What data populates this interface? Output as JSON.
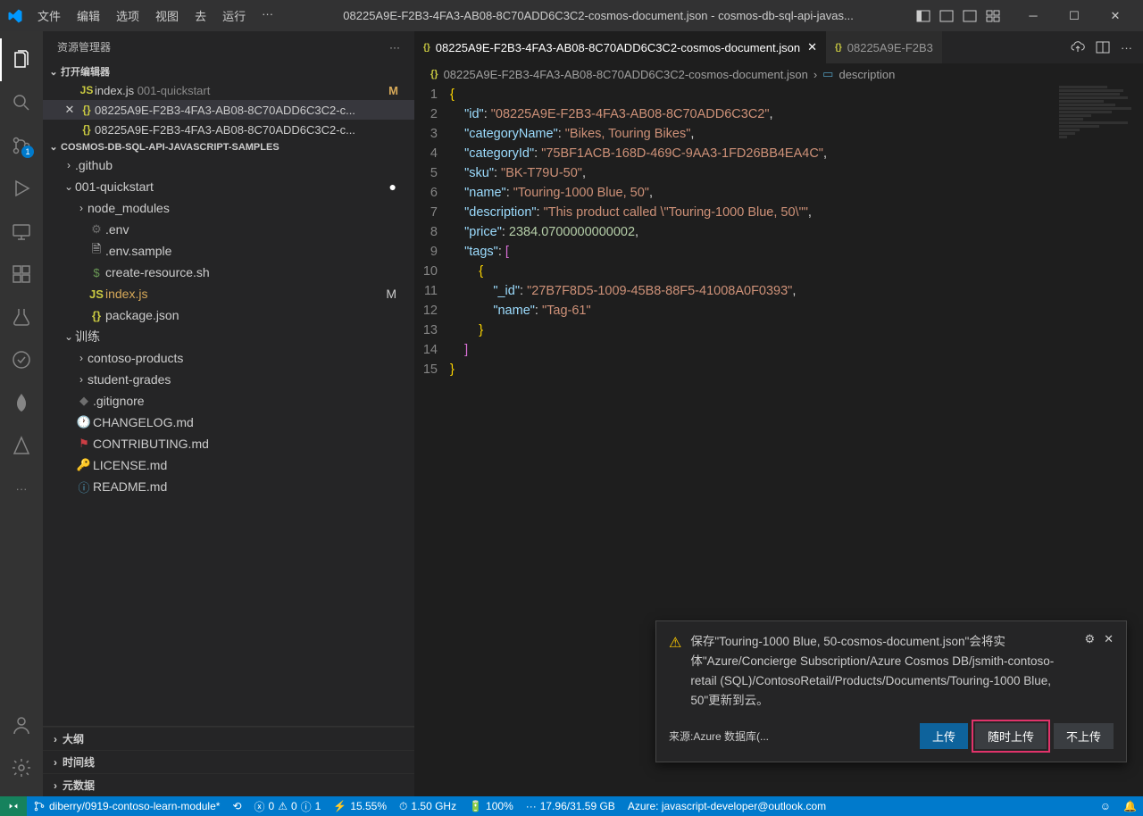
{
  "titlebar": {
    "title": "08225A9E-F2B3-4FA3-AB08-8C70ADD6C3C2-cosmos-document.json - cosmos-db-sql-api-javas...",
    "menu": [
      "文件",
      "编辑",
      "选项",
      "视图",
      "去",
      "运行",
      "···"
    ]
  },
  "sidebar": {
    "title": "资源管理器",
    "open_editors": "打开编辑器",
    "editors": [
      {
        "name": "index.js",
        "detail": "001-quickstart",
        "icon": "JS",
        "modified": "M"
      },
      {
        "name": "08225A9E-F2B3-4FA3-AB08-8C70ADD6C3C2-c...",
        "icon": "{}",
        "active": true,
        "close_visible": true
      },
      {
        "name": "08225A9E-F2B3-4FA3-AB08-8C70ADD6C3C2-c...",
        "icon": "{}"
      }
    ],
    "workspace": "COSMOS-DB-SQL-API-JAVASCRIPT-SAMPLES",
    "tree": [
      {
        "type": "folder",
        "name": ".github",
        "indent": 1,
        "expanded": false
      },
      {
        "type": "folder",
        "name": "001-quickstart",
        "indent": 1,
        "expanded": true,
        "dot": true
      },
      {
        "type": "folder",
        "name": "node_modules",
        "indent": 2,
        "expanded": false
      },
      {
        "type": "file",
        "name": ".env",
        "indent": 2,
        "iconClass": "i-gear",
        "icon": "⚙"
      },
      {
        "type": "file",
        "name": ".env.sample",
        "indent": 2,
        "iconClass": "i-folder",
        "icon": "🗎"
      },
      {
        "type": "file",
        "name": "create-resource.sh",
        "indent": 2,
        "iconClass": "i-dollar",
        "icon": "$"
      },
      {
        "type": "file",
        "name": "index.js",
        "indent": 2,
        "iconClass": "i-js",
        "icon": "JS",
        "mod": "M",
        "modified": true
      },
      {
        "type": "file",
        "name": "package.json",
        "indent": 2,
        "iconClass": "i-json",
        "icon": "{}"
      },
      {
        "type": "folder",
        "name": "训练",
        "indent": 1,
        "expanded": true
      },
      {
        "type": "folder",
        "name": "contoso-products",
        "indent": 2,
        "expanded": false
      },
      {
        "type": "folder",
        "name": "student-grades",
        "indent": 2,
        "expanded": false
      },
      {
        "type": "file",
        "name": ".gitignore",
        "indent": 1,
        "iconClass": "i-gear",
        "icon": "◆"
      },
      {
        "type": "file",
        "name": "CHANGELOG.md",
        "indent": 1,
        "iconClass": "i-info",
        "icon": "🕐"
      },
      {
        "type": "file",
        "name": "CONTRIBUTING.md",
        "indent": 1,
        "iconClass": "i-contrib",
        "icon": "⚑"
      },
      {
        "type": "file",
        "name": "LICENSE.md",
        "indent": 1,
        "iconClass": "i-license",
        "icon": "🔑"
      },
      {
        "type": "file",
        "name": "README.md",
        "indent": 1,
        "iconClass": "i-info",
        "icon": "ⓘ"
      }
    ],
    "panels": [
      "大纲",
      "时间线",
      "元数据"
    ]
  },
  "tabs": [
    {
      "name": "08225A9E-F2B3-4FA3-AB08-8C70ADD6C3C2-cosmos-document.json",
      "active": true
    },
    {
      "name": "08225A9E-F2B3",
      "active": false
    }
  ],
  "breadcrumb": {
    "file": "08225A9E-F2B3-4FA3-AB08-8C70ADD6C3C2-cosmos-document.json",
    "symbol": "description"
  },
  "code": {
    "lines": [
      [
        [
          "brace",
          "{"
        ]
      ],
      [
        [
          "ind",
          4
        ],
        [
          "key",
          "\"id\""
        ],
        [
          "punc",
          ": "
        ],
        [
          "str",
          "\"08225A9E-F2B3-4FA3-AB08-8C70ADD6C3C2\""
        ],
        [
          "punc",
          ","
        ]
      ],
      [
        [
          "ind",
          4
        ],
        [
          "key",
          "\"categoryName\""
        ],
        [
          "punc",
          ": "
        ],
        [
          "str",
          "\"Bikes, Touring Bikes\""
        ],
        [
          "punc",
          ","
        ]
      ],
      [
        [
          "ind",
          4
        ],
        [
          "key",
          "\"categoryId\""
        ],
        [
          "punc",
          ": "
        ],
        [
          "str",
          "\"75BF1ACB-168D-469C-9AA3-1FD26BB4EA4C\""
        ],
        [
          "punc",
          ","
        ]
      ],
      [
        [
          "ind",
          4
        ],
        [
          "key",
          "\"sku\""
        ],
        [
          "punc",
          ": "
        ],
        [
          "str",
          "\"BK-T79U-50\""
        ],
        [
          "punc",
          ","
        ]
      ],
      [
        [
          "ind",
          4
        ],
        [
          "key",
          "\"name\""
        ],
        [
          "punc",
          ": "
        ],
        [
          "str",
          "\"Touring-1000 Blue, 50\""
        ],
        [
          "punc",
          ","
        ]
      ],
      [
        [
          "ind",
          4
        ],
        [
          "key",
          "\"description\""
        ],
        [
          "punc",
          ": "
        ],
        [
          "str",
          "\"This product called \\\"Touring-1000 Blue, 50\\\"\""
        ],
        [
          "punc",
          ","
        ]
      ],
      [
        [
          "ind",
          4
        ],
        [
          "key",
          "\"price\""
        ],
        [
          "punc",
          ": "
        ],
        [
          "num",
          "2384.0700000000002"
        ],
        [
          "punc",
          ","
        ]
      ],
      [
        [
          "ind",
          4
        ],
        [
          "key",
          "\"tags\""
        ],
        [
          "punc",
          ": "
        ],
        [
          "brack",
          "["
        ]
      ],
      [
        [
          "ind",
          8
        ],
        [
          "brace",
          "{"
        ]
      ],
      [
        [
          "ind",
          12
        ],
        [
          "key",
          "\"_id\""
        ],
        [
          "punc",
          ": "
        ],
        [
          "str",
          "\"27B7F8D5-1009-45B8-88F5-41008A0F0393\""
        ],
        [
          "punc",
          ","
        ]
      ],
      [
        [
          "ind",
          12
        ],
        [
          "key",
          "\"name\""
        ],
        [
          "punc",
          ": "
        ],
        [
          "str",
          "\"Tag-61\""
        ]
      ],
      [
        [
          "ind",
          8
        ],
        [
          "brace",
          "}"
        ]
      ],
      [
        [
          "ind",
          4
        ],
        [
          "brack",
          "]"
        ]
      ],
      [
        [
          "brace",
          "}"
        ]
      ]
    ]
  },
  "notification": {
    "message": "保存\"Touring-1000 Blue, 50-cosmos-document.json\"会将实体\"Azure/Concierge Subscription/Azure Cosmos DB/jsmith-contoso-retail (SQL)/ContosoRetail/Products/Documents/Touring-1000 Blue, 50\"更新到云。",
    "source": "来源:Azure 数据库(...",
    "buttons": {
      "upload": "上传",
      "always": "随时上传",
      "never": "不上传"
    }
  },
  "statusbar": {
    "branch": "diberry/0919-contoso-learn-module*",
    "sync": "⟲",
    "errors": "0",
    "warnings": "0",
    "info": "1",
    "cpu": "15.55%",
    "ghz": "1.50 GHz",
    "battery": "100%",
    "mem": "17.96/31.59 GB",
    "azure": "Azure: javascript-developer@outlook.com"
  },
  "activitybar": {
    "scm_badge": "1"
  }
}
